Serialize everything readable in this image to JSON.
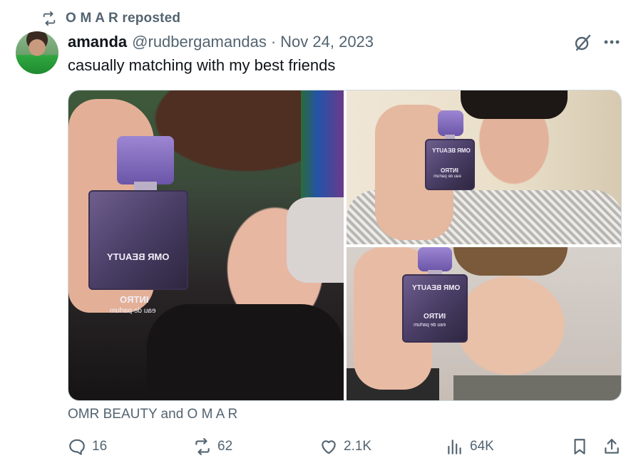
{
  "repost_banner": {
    "text": "O M A R reposted",
    "icon": "repost-icon"
  },
  "author": {
    "name": "amanda",
    "handle": "@rudbergamandas",
    "separator": "·",
    "date": "Nov 24, 2023",
    "avatar": "avatar"
  },
  "tweet": {
    "text": "casually matching with my best friends"
  },
  "media": {
    "images": [
      {
        "alt": "person-holding-perfume-bottle",
        "bottle_brand": "OMR BEAUTY",
        "bottle_name": "INTRO",
        "bottle_sub": "eau de parfum"
      },
      {
        "alt": "person-holding-perfume-bottle",
        "bottle_brand": "OMR BEAUTY",
        "bottle_name": "INTRO",
        "bottle_sub": "eau de parfum"
      },
      {
        "alt": "person-holding-perfume-bottle",
        "bottle_brand": "OMR BEAUTY",
        "bottle_name": "INTRO",
        "bottle_sub": "eau de parfum"
      }
    ]
  },
  "tagged": {
    "text": "OMR BEAUTY and O M A R"
  },
  "actions": {
    "reply": {
      "icon": "reply-icon",
      "count": "16"
    },
    "repost": {
      "icon": "repost-icon",
      "count": "62"
    },
    "like": {
      "icon": "heart-icon",
      "count": "2.1K"
    },
    "views": {
      "icon": "views-icon",
      "count": "64K"
    },
    "bookmark": {
      "icon": "bookmark-icon"
    },
    "share": {
      "icon": "share-icon"
    }
  },
  "colors": {
    "text_primary": "#0f1419",
    "text_secondary": "#536471",
    "border": "#cfd9de"
  }
}
